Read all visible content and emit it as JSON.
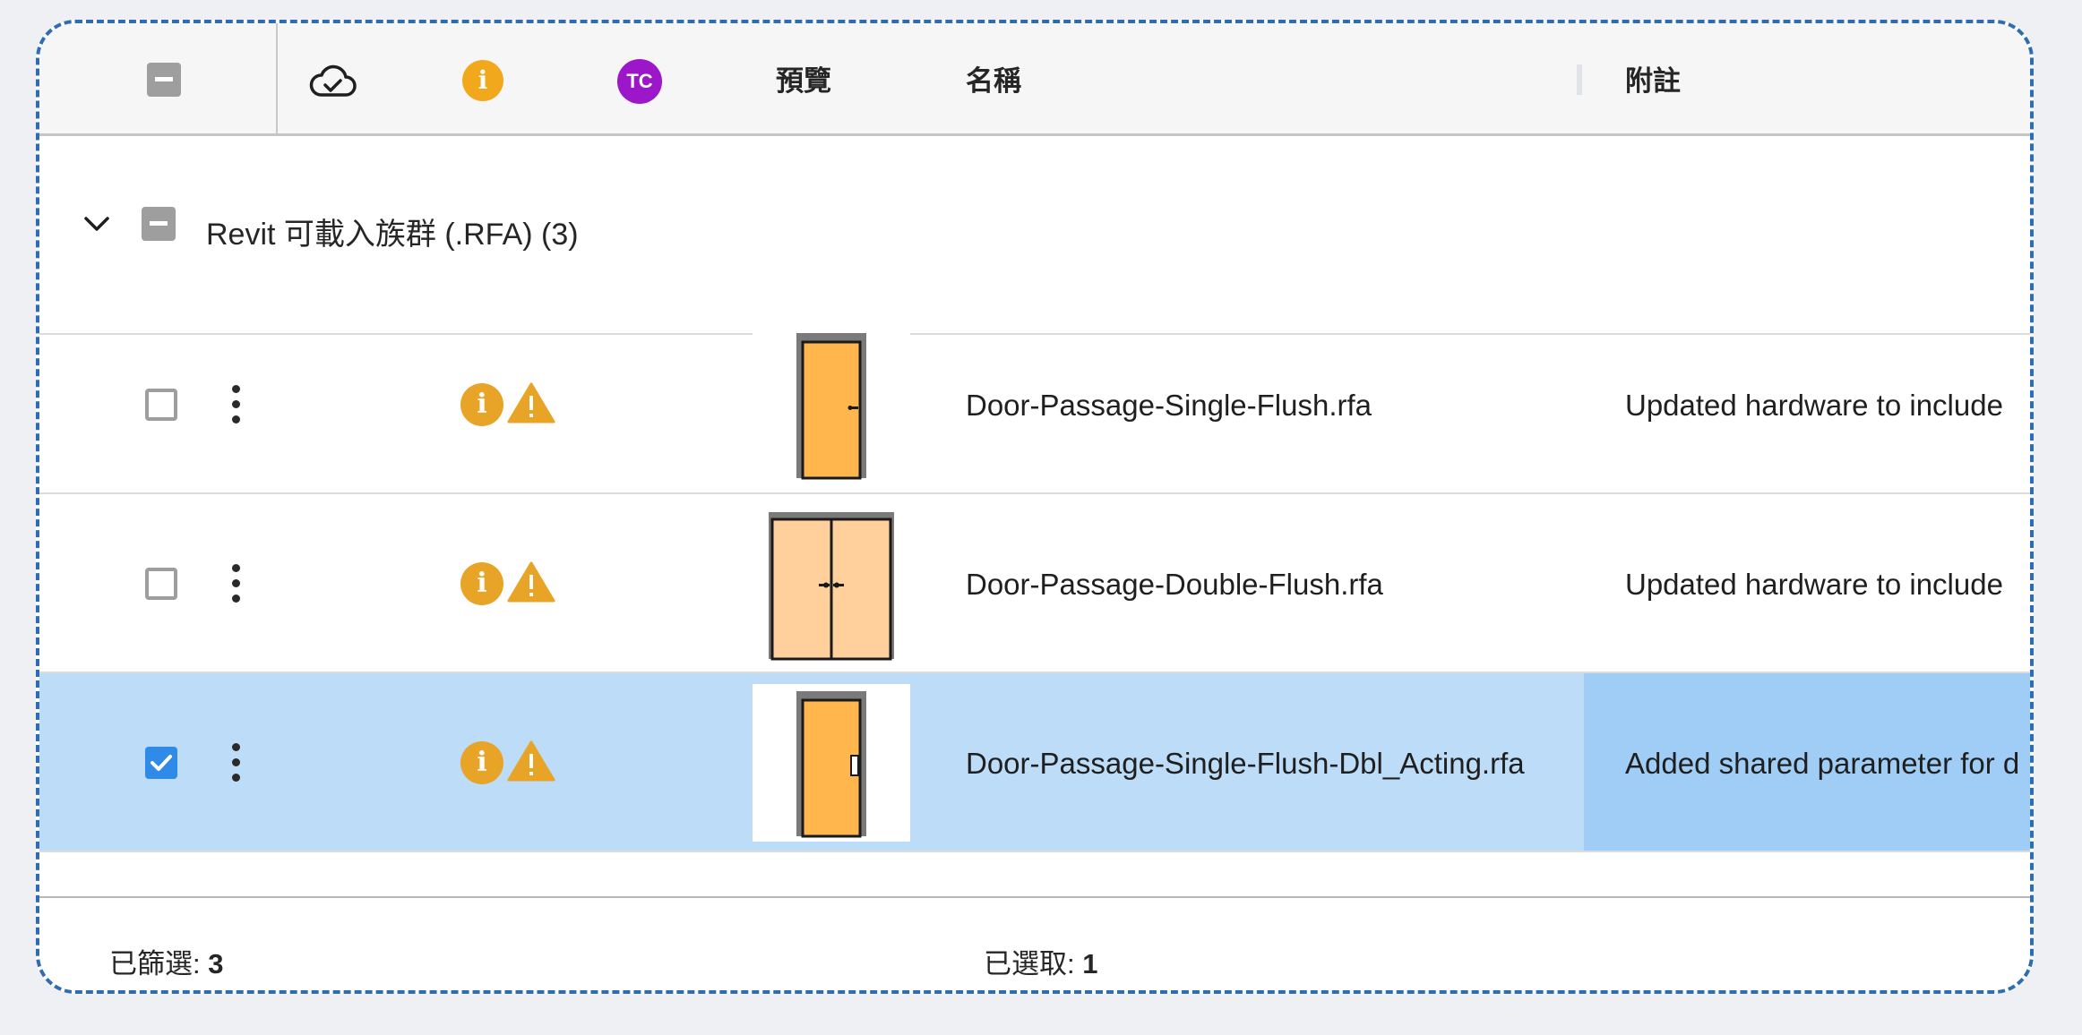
{
  "header": {
    "preview_label": "預覽",
    "name_label": "名稱",
    "notes_label": "附註",
    "tc_badge": "TC",
    "info_glyph": "i",
    "icons": [
      "select-all-checkbox",
      "cloud-check-icon",
      "info-icon",
      "tc-avatar"
    ]
  },
  "group": {
    "label": "Revit 可載入族群 (.RFA) (3)",
    "expanded": true
  },
  "rows": [
    {
      "name": "Door-Passage-Single-Flush.rfa",
      "note": "Updated hardware to include",
      "checked": false,
      "preview": "single-door"
    },
    {
      "name": "Door-Passage-Double-Flush.rfa",
      "note": "Updated hardware to include",
      "checked": false,
      "preview": "double-door"
    },
    {
      "name": "Door-Passage-Single-Flush-Dbl_Acting.rfa",
      "note": "Added shared parameter for d",
      "checked": true,
      "preview": "single-door-dbl-acting"
    }
  ],
  "footer": {
    "filtered_label": "已篩選: ",
    "filtered_count": "3",
    "selected_label": "已選取: ",
    "selected_count": "1"
  },
  "colors": {
    "selected_row": "#bcdcf7",
    "selected_note": "#9fcdf5",
    "warning": "#e8a426",
    "tc_purple": "#9b17c9",
    "checkbox_checked": "#2f8ae8",
    "door_fill": "#ffb74d",
    "door_fill_light": "#ffd09c"
  }
}
